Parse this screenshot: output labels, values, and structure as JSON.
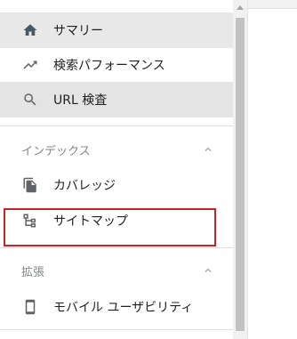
{
  "nav": {
    "items": [
      {
        "label": "サマリー",
        "icon": "home-icon"
      },
      {
        "label": "検索パフォーマンス",
        "icon": "trending-up-icon"
      },
      {
        "label": "URL 検査",
        "icon": "search-icon"
      }
    ]
  },
  "sections": [
    {
      "title": "インデックス",
      "items": [
        {
          "label": "カバレッジ",
          "icon": "file-copy-icon"
        },
        {
          "label": "サイトマップ",
          "icon": "sitemap-icon"
        }
      ]
    },
    {
      "title": "拡張",
      "items": [
        {
          "label": "モバイル ユーザビリティ",
          "icon": "smartphone-icon"
        }
      ]
    }
  ],
  "colors": {
    "highlight_box": "#d0212a",
    "active_bg": "#e8e8e8",
    "icon": "#5f6368",
    "active_icon": "#455a64"
  }
}
